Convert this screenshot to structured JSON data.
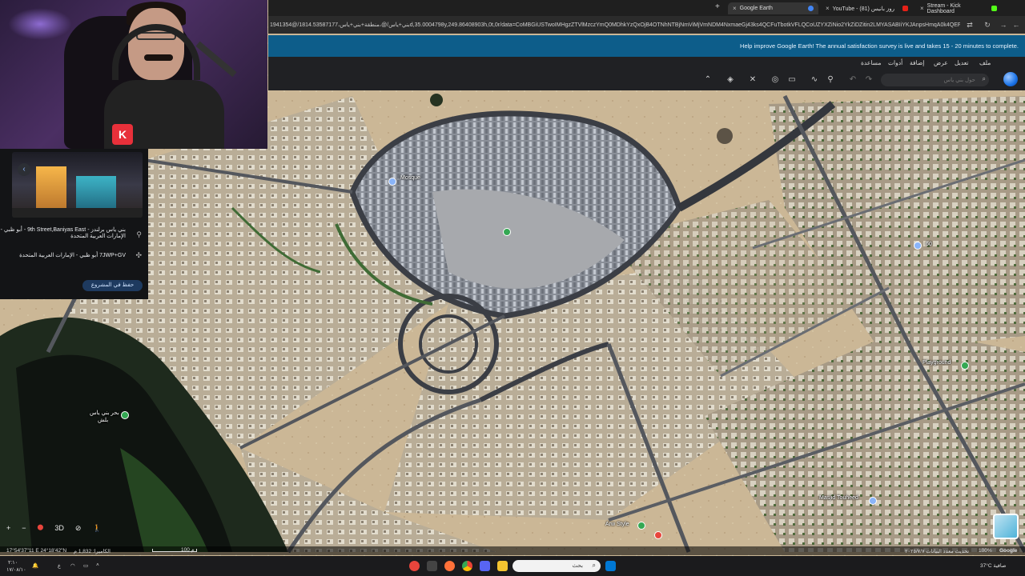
{
  "browser": {
    "tabs": [
      {
        "label": "Google Earth",
        "active": true
      },
      {
        "label": "YouTube - روز بانيس (81)",
        "active": false
      },
      {
        "label": "Stream - Kick Dashboard",
        "active": false
      }
    ],
    "url": "1941354@/بني+ياس/@،منطقة+بني+ياس،1814.53587177d,35.0004798y,249.86408903h,0t,0r/data=CoMBGiUSTwoIMHgzZTVlMzczYmQ0MDhkYzQxOjB4OTNhNTBjNmViMjVmNDM4NxmaeGj43ks4QCFuTbotkVFLQCoUZYXZiNio2YkZiDZitin2LMYASABIiYKJAnpsHmqA0k4QEFhBxNVBT44QCEdl2LMHf",
    "survey_text": "Help improve Google Earth! The annual satisfaction survey is live and takes 15 - 20 minutes to complete.",
    "accent": "#0d5d8a"
  },
  "menu": [
    "ملف",
    "تعديل",
    "عرض",
    "إضافة",
    "أدوات",
    "مساعدة"
  ],
  "toolbar": {
    "search_placeholder": "حول بني ياس",
    "tools": [
      "search-icon",
      "pin-icon",
      "path-icon",
      "measure-icon",
      "layers-icon",
      "street-view-icon",
      "tools-icon",
      "stack-icon",
      "chevron-up-icon",
      "undo-icon",
      "redo-icon"
    ]
  },
  "side_panel": {
    "back_glyph": "‹",
    "place_line1": "بني ياس برلندز - 9th Street,Baniyas East - أبو ظبي - الإمارات العربية المتحدة",
    "place_line2": "7JWP+GV أبو ظبي - الإمارات العربية المتحدة",
    "save_label": "حفظ في المشروع"
  },
  "map_labels": {
    "mosque": "Mosque",
    "playground": "Playground",
    "masjid": "Masjid Touheed",
    "arw_style": "Arw Style",
    "lake": "بحر بني ياس",
    "lake2": "بلش",
    "road_number": "60"
  },
  "map_controls": [
    "+",
    "−",
    "⬤",
    "3D",
    "⊘",
    "🚶"
  ],
  "status": {
    "coords": "17°54'37\"11 E 24°18'42\"N",
    "camera": "الكاميرا: 1,832 م",
    "scale": "100 م",
    "date": "تحديث معدد البيانات ٢٠٢٥/٧/٧",
    "zoom": "100%",
    "brand": "Google"
  },
  "taskbar": {
    "search_label": "بحث",
    "time": "٢:١٠",
    "date": "١٧/٠٨/١٠",
    "weather": "37°C صافية"
  },
  "webcam": {
    "kick_letter": "K"
  }
}
